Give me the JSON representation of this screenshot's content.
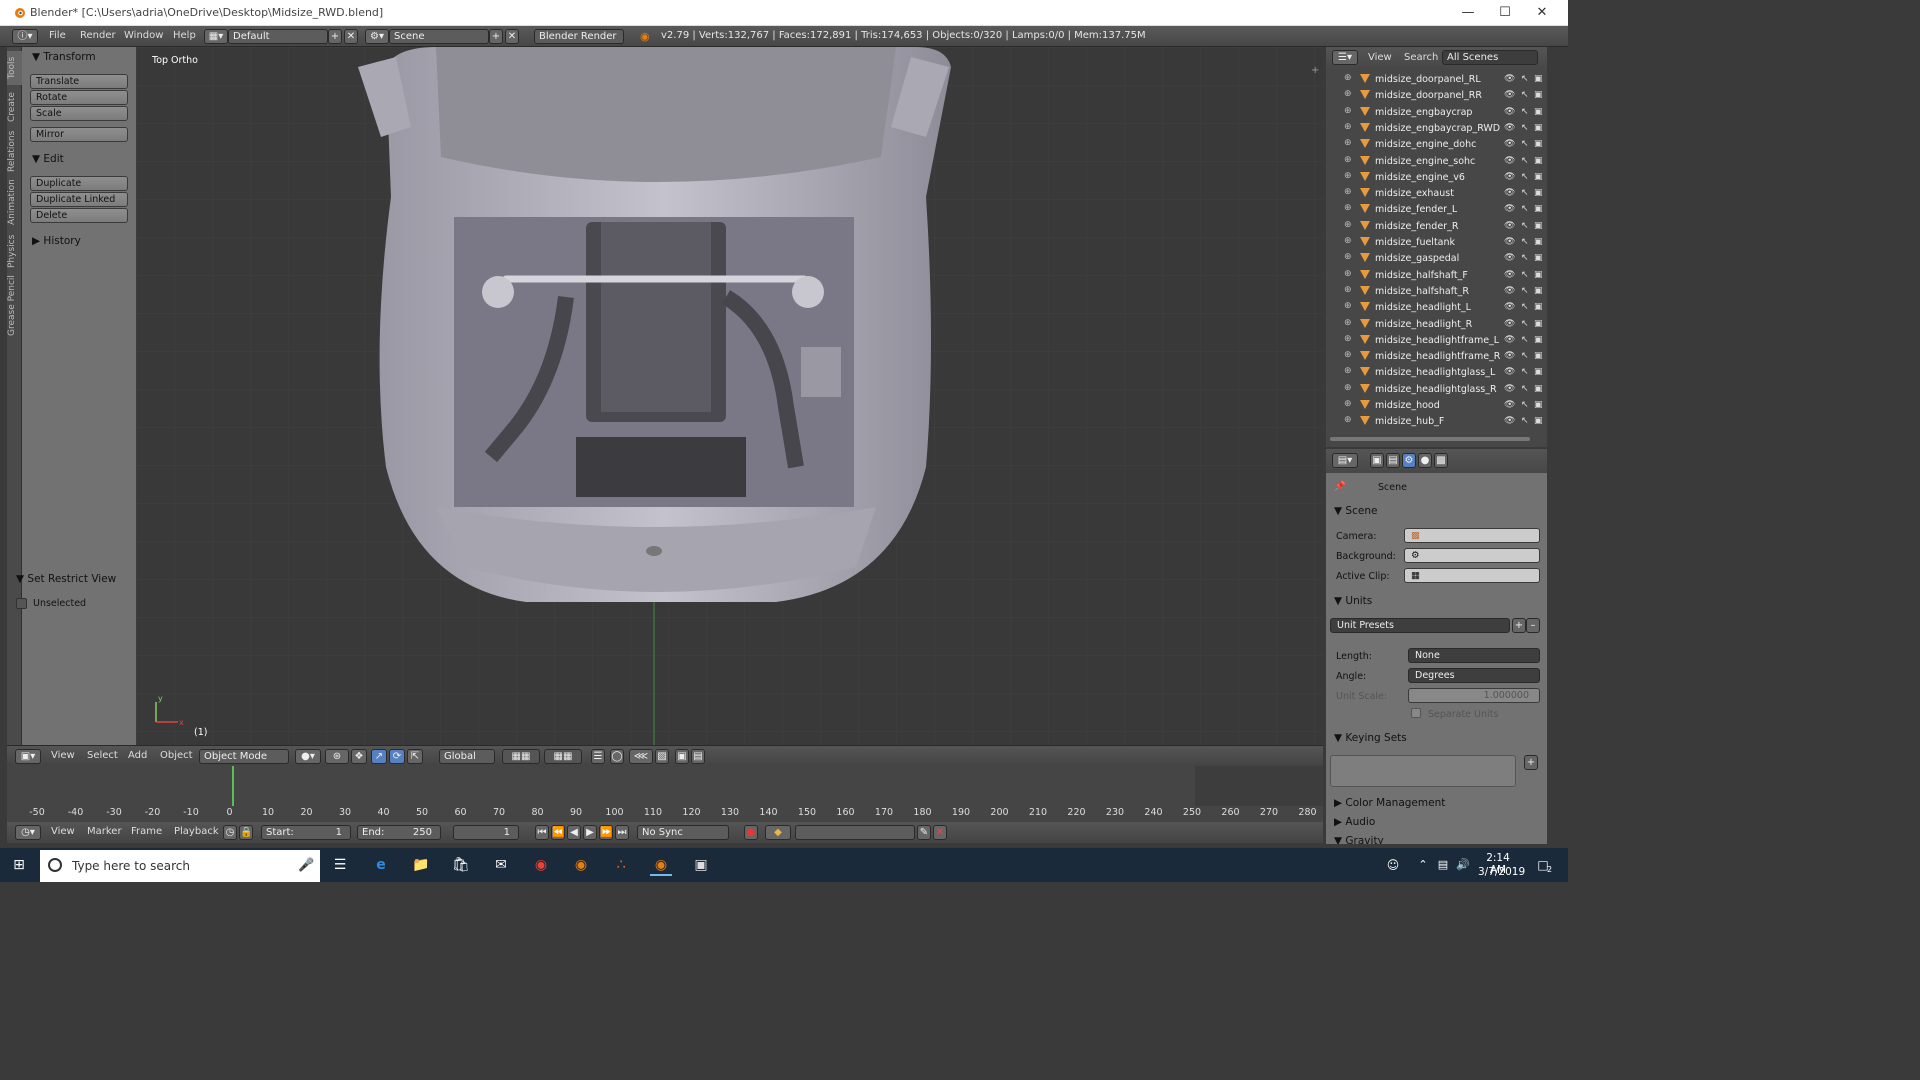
{
  "window": {
    "title": "Blender* [C:\\Users\\adria\\OneDrive\\Desktop\\Midsize_RWD.blend]"
  },
  "menu": {
    "file": "File",
    "render": "Render",
    "window": "Window",
    "help": "Help",
    "layout": "Default",
    "scene": "Scene",
    "engine": "Blender Render",
    "stats": "v2.79 | Verts:132,767 | Faces:172,891 | Tris:174,653 | Objects:0/320 | Lamps:0/0 | Mem:137.75M"
  },
  "tool_tabs": [
    "Tools",
    "Create",
    "Relations",
    "Animation",
    "Physics",
    "Grease Pencil"
  ],
  "tools": {
    "transform_header": "Transform",
    "translate": "Translate",
    "rotate": "Rotate",
    "scale": "Scale",
    "mirror": "Mirror",
    "edit_header": "Edit",
    "duplicate": "Duplicate",
    "duplicate_linked": "Duplicate Linked",
    "delete": "Delete",
    "history_header": "History",
    "restrict_header": "Set Restrict View",
    "unselected": "Unselected"
  },
  "viewport": {
    "label": "Top Ortho",
    "frame_indicator": "(1)"
  },
  "view3d_header": {
    "view": "View",
    "select": "Select",
    "add": "Add",
    "object": "Object",
    "mode": "Object Mode",
    "orientation": "Global"
  },
  "timeline": {
    "ticks": [
      "-50",
      "-40",
      "-30",
      "-20",
      "-10",
      "0",
      "10",
      "20",
      "30",
      "40",
      "50",
      "60",
      "70",
      "80",
      "90",
      "100",
      "110",
      "120",
      "130",
      "140",
      "150",
      "160",
      "170",
      "180",
      "190",
      "200",
      "210",
      "220",
      "230",
      "240",
      "250",
      "260",
      "270",
      "280"
    ],
    "view": "View",
    "marker": "Marker",
    "frame": "Frame",
    "playback": "Playback",
    "start_label": "Start:",
    "start_value": "1",
    "end_label": "End:",
    "end_value": "250",
    "current": "1",
    "sync": "No Sync"
  },
  "outliner": {
    "view": "View",
    "search": "Search",
    "filter": "All Scenes",
    "items": [
      "midsize_doorpanel_RL",
      "midsize_doorpanel_RR",
      "midsize_engbaycrap",
      "midsize_engbaycrap_RWD",
      "midsize_engine_dohc",
      "midsize_engine_sohc",
      "midsize_engine_v6",
      "midsize_exhaust",
      "midsize_fender_L",
      "midsize_fender_R",
      "midsize_fueltank",
      "midsize_gaspedal",
      "midsize_halfshaft_F",
      "midsize_halfshaft_R",
      "midsize_headlight_L",
      "midsize_headlight_R",
      "midsize_headlightframe_L",
      "midsize_headlightframe_R",
      "midsize_headlightglass_L",
      "midsize_headlightglass_R",
      "midsize_hood",
      "midsize_hub_F"
    ]
  },
  "properties": {
    "context": "Scene",
    "scene_header": "Scene",
    "camera_label": "Camera:",
    "background_label": "Background:",
    "clip_label": "Active Clip:",
    "units_header": "Units",
    "unit_presets": "Unit Presets",
    "length_label": "Length:",
    "length_value": "None",
    "angle_label": "Angle:",
    "angle_value": "Degrees",
    "unit_scale_label": "Unit Scale:",
    "unit_scale_value": "1.000000",
    "separate_units": "Separate Units",
    "keying_header": "Keying Sets",
    "color_mgmt": "Color Management",
    "audio": "Audio",
    "gravity": "Gravity"
  },
  "taskbar": {
    "search": "Type here to search",
    "time": "2:14 AM",
    "date": "3/7/2019",
    "notif": "2"
  }
}
